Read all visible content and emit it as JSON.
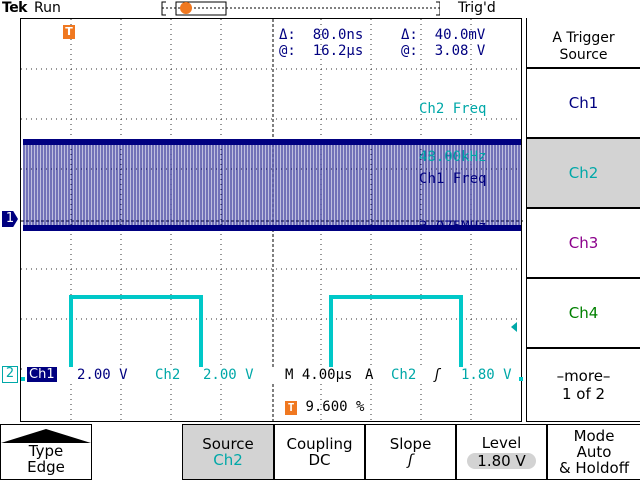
{
  "status": {
    "brand": "Tek",
    "run_state": "Run",
    "trigger_state": "Trig'd"
  },
  "cursor_readout": {
    "delta_time_symbol": "Δ:",
    "delta_time": "80.0ns",
    "delta_volt_symbol": "Δ:",
    "delta_volt": "40.0mV",
    "at_time_symbol": "@:",
    "at_time": "16.2µs",
    "at_volt_symbol": "@:",
    "at_volt": "3.08 V"
  },
  "measurements": {
    "ch2_freq_label": "Ch2 Freq",
    "ch2_freq_value": "48.00kHz",
    "ch1_freq_label": "Ch1 Freq",
    "ch1_freq_value": "3.075MHz"
  },
  "status_line": {
    "ch1_label": "Ch1",
    "ch1_scale": "2.00 V",
    "ch2_label": "Ch2",
    "ch2_scale": "2.00 V",
    "timebase": "M 4.00µs",
    "trigger_mode_letter": "A",
    "trigger_source": "Ch2",
    "trigger_slope": "ʃ",
    "trigger_level": "1.80 V"
  },
  "trigger_position": {
    "icon": "T",
    "value": "9.600 %"
  },
  "markers": {
    "ch1_ground": "1",
    "ch2_ground": "2",
    "trigger_top": "T"
  },
  "side_menu": {
    "title": "A Trigger Source",
    "items": [
      {
        "label": "Ch1",
        "color": "#000080",
        "selected": false
      },
      {
        "label": "Ch2",
        "color": "#00a8a8",
        "selected": true
      },
      {
        "label": "Ch3",
        "color": "#8b008b",
        "selected": false
      },
      {
        "label": "Ch4",
        "color": "#008000",
        "selected": false
      }
    ],
    "more_line1": "–more–",
    "more_line2": "1 of 2"
  },
  "bottom_menu": {
    "type_label": "Type",
    "type_value": "Edge",
    "source_label": "Source",
    "source_value": "Ch2",
    "coupling_label": "Coupling",
    "coupling_value": "DC",
    "slope_label": "Slope",
    "slope_value": "ʃ",
    "level_label": "Level",
    "level_value": "1.80 V",
    "mode_label_line1": "Mode",
    "mode_label_line2": "Auto",
    "mode_label_line3": "& Holdoff"
  },
  "colors": {
    "ch1": "#000080",
    "ch2": "#00c8c8",
    "trigger": "#f07820",
    "grid": "#000000"
  }
}
